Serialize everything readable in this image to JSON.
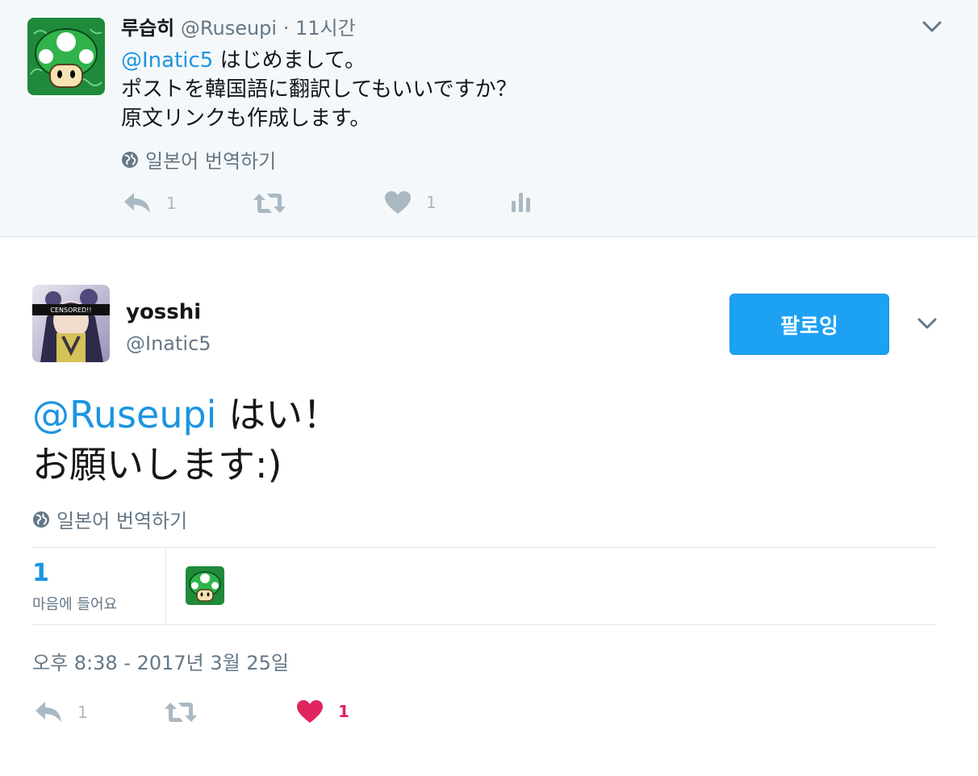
{
  "parent_tweet": {
    "display_name": "루습히",
    "handle": "@Ruseupi",
    "separator": "·",
    "time": "11시간",
    "mention": "@Inatic5",
    "line1_rest": " はじめまして。",
    "line2": "ポストを韓国語に翻訳してもいいですか？",
    "line3": "原文リンクも作成します。",
    "translate_label": "일본어 번역하기",
    "reply_count": "1",
    "like_count": "1"
  },
  "main_tweet": {
    "display_name": "yosshi",
    "handle": "@Inatic5",
    "avatar_caption": "CENSORED!!",
    "follow_label": "팔로잉",
    "mention": "@Ruseupi",
    "line1_rest": " はい！",
    "line2": "お願いします:)",
    "translate_label": "일본어 번역하기",
    "likes_stat_count": "1",
    "likes_stat_label": "마음에 들어요",
    "timestamp": "오후 8:38 - 2017년 3월 25일",
    "reply_count": "1",
    "like_count": "1"
  },
  "colors": {
    "accent": "#1da1f2",
    "link": "#1b95e0",
    "muted": "#657786",
    "icon": "#aab8c2",
    "liked": "#e0245e",
    "parent_bg": "#f5f8fa"
  },
  "icons": [
    "globe-icon",
    "reply-icon",
    "retweet-icon",
    "heart-icon",
    "analytics-icon",
    "chevron-down-icon"
  ]
}
